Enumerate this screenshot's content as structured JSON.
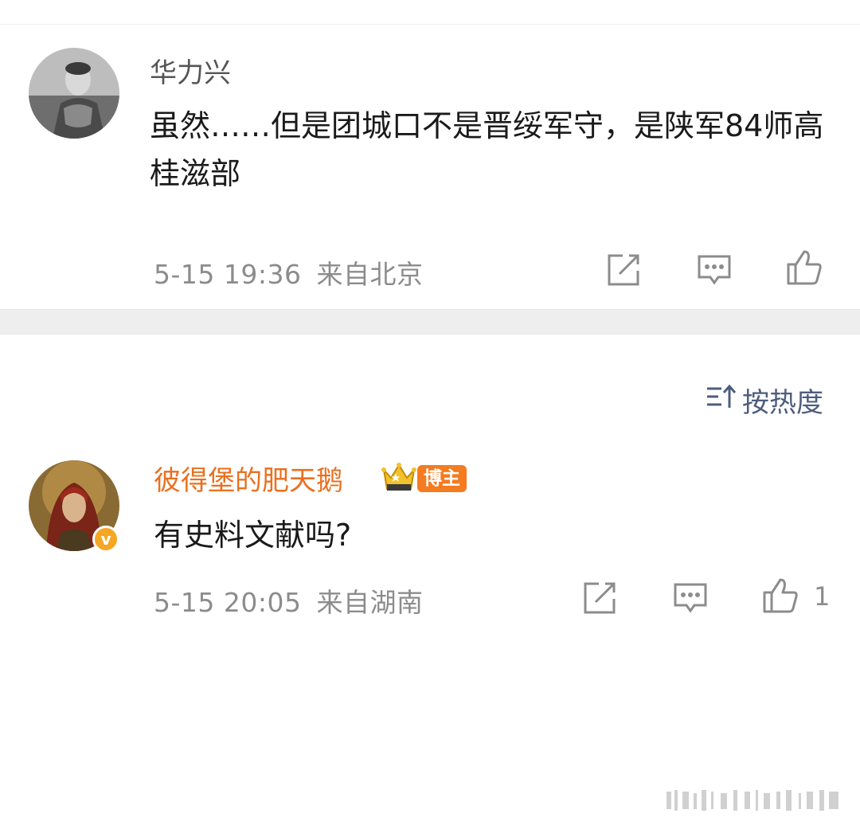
{
  "comments": [
    {
      "username": "华力兴",
      "content": "虽然……但是团城口不是晋绥军守，是陕军84师高桂滋部",
      "time": "5-15 19:36",
      "location": "来自北京",
      "like_count": ""
    },
    {
      "username": "彼得堡的肥天鹅",
      "badge_label": "博主",
      "content": "有史料文献吗?",
      "time": "5-15 20:05",
      "location": "来自湖南",
      "like_count": "1"
    }
  ],
  "sort": {
    "label": "按热度"
  },
  "colors": {
    "username_default": "#555555",
    "username_vip": "#e9701f",
    "meta_gray": "#8c8c8c",
    "sort_blue": "#4d5d7e",
    "badge_orange": "#f47b20",
    "verified_gold": "#f5a623"
  },
  "icons": [
    "forward-icon",
    "comment-icon",
    "like-icon",
    "sort-icon",
    "crown-badge-icon",
    "verified-icon"
  ]
}
